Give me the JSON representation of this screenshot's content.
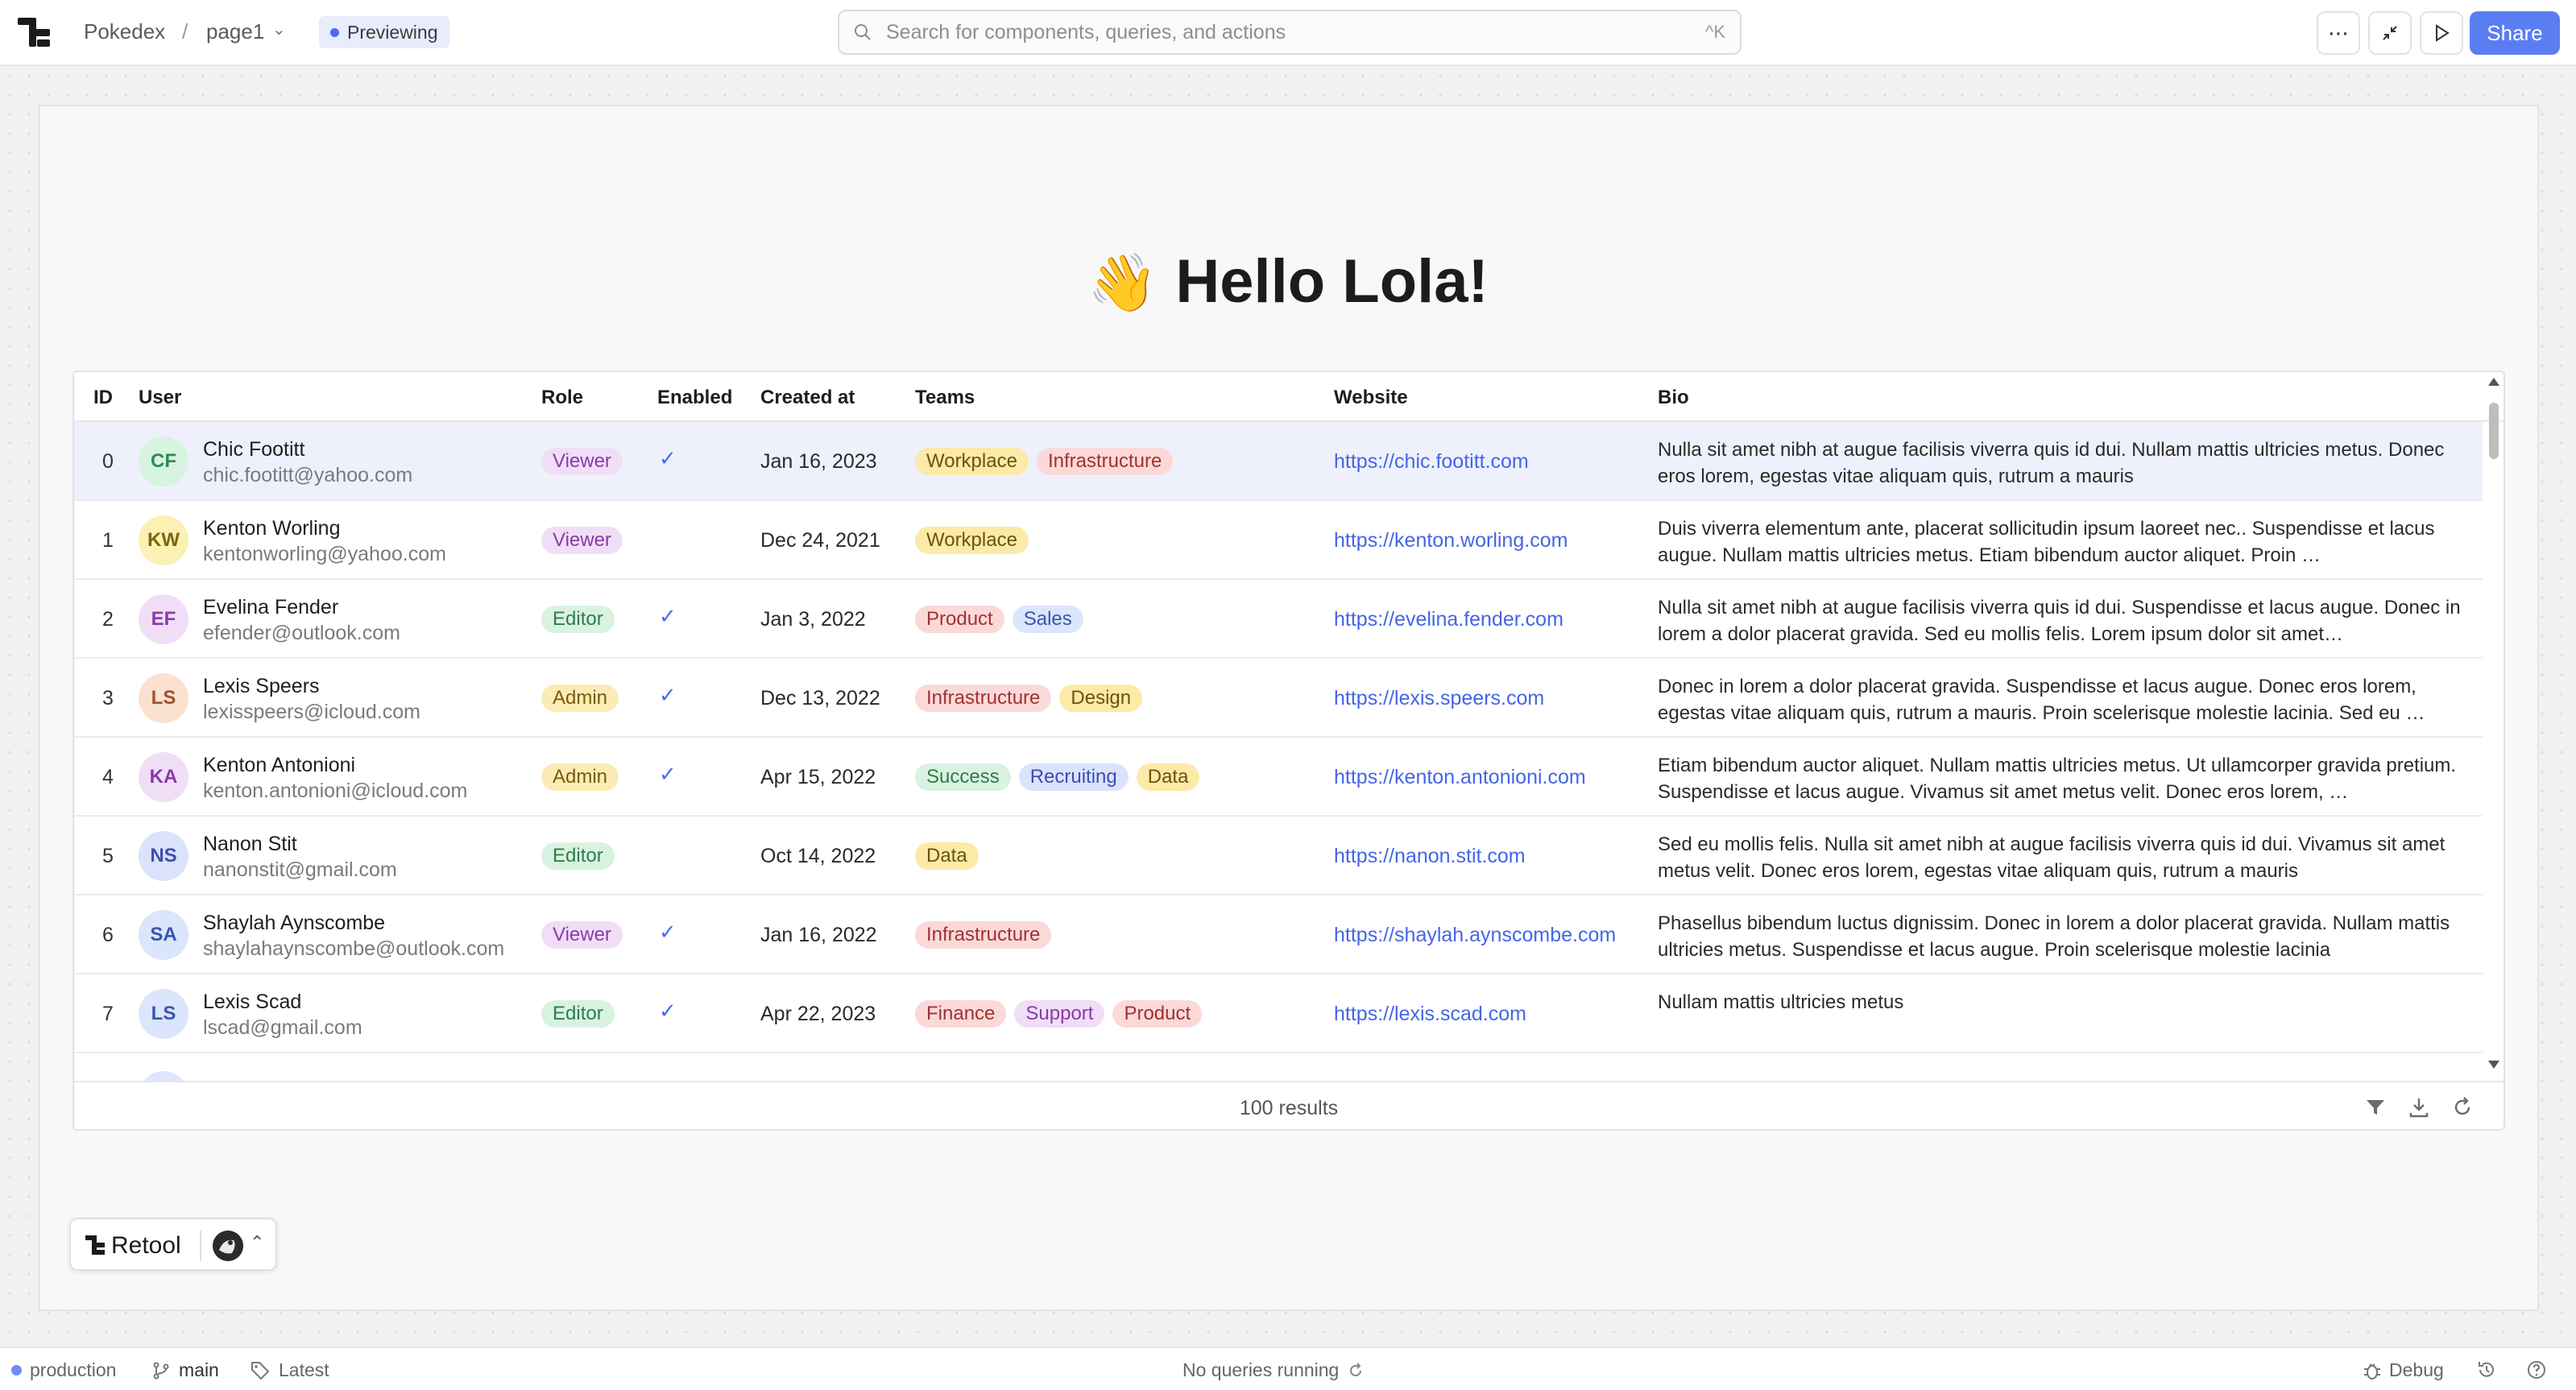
{
  "app": {
    "name": "Pokedex",
    "separator": "/",
    "page": "page1",
    "mode_badge": "Previewing"
  },
  "search": {
    "placeholder": "Search for components, queries, and actions",
    "shortcut": "^K"
  },
  "toolbar": {
    "more_icon": "more-horizontal-icon",
    "collapse_icon": "minimize-icon",
    "play_icon": "play-icon",
    "share_label": "Share"
  },
  "canvas": {
    "greeting_emoji": "👋",
    "greeting": "Hello Lola!"
  },
  "table": {
    "columns": [
      "ID",
      "User",
      "Role",
      "Enabled",
      "Created at",
      "Teams",
      "Website",
      "Bio"
    ],
    "rows": [
      {
        "id": "0",
        "initials": "CF",
        "name": "Chic Footitt",
        "email": "chic.footitt@yahoo.com",
        "role": "Viewer",
        "enabled": true,
        "created": "Jan 16, 2023",
        "teams": [
          "Workplace",
          "Infrastructure"
        ],
        "website": "https://chic.footitt.com",
        "bio": "Nulla sit amet nibh at augue facilisis viverra quis id dui. Nullam mattis ultricies metus. Donec eros lorem, egestas vitae aliquam quis, rutrum a mauris"
      },
      {
        "id": "1",
        "initials": "KW",
        "name": "Kenton Worling",
        "email": "kentonworling@yahoo.com",
        "role": "Viewer",
        "enabled": false,
        "created": "Dec 24, 2021",
        "teams": [
          "Workplace"
        ],
        "website": "https://kenton.worling.com",
        "bio": "Duis viverra elementum ante, placerat sollicitudin ipsum laoreet nec.. Suspendisse et lacus augue. Nullam mattis ultricies metus. Etiam bibendum auctor aliquet. Proin …"
      },
      {
        "id": "2",
        "initials": "EF",
        "name": "Evelina Fender",
        "email": "efender@outlook.com",
        "role": "Editor",
        "enabled": true,
        "created": "Jan 3, 2022",
        "teams": [
          "Product",
          "Sales"
        ],
        "website": "https://evelina.fender.com",
        "bio": "Nulla sit amet nibh at augue facilisis viverra quis id dui. Suspendisse et lacus augue. Donec in lorem a dolor placerat gravida. Sed eu mollis felis. Lorem ipsum dolor sit amet…"
      },
      {
        "id": "3",
        "initials": "LS",
        "name": "Lexis Speers",
        "email": "lexisspeers@icloud.com",
        "role": "Admin",
        "enabled": true,
        "created": "Dec 13, 2022",
        "teams": [
          "Infrastructure",
          "Design"
        ],
        "website": "https://lexis.speers.com",
        "bio": "Donec in lorem a dolor placerat gravida. Suspendisse et lacus augue. Donec eros lorem, egestas vitae aliquam quis, rutrum a mauris. Proin scelerisque molestie lacinia. Sed eu …"
      },
      {
        "id": "4",
        "initials": "KA",
        "name": "Kenton Antonioni",
        "email": "kenton.antonioni@icloud.com",
        "role": "Admin",
        "enabled": true,
        "created": "Apr 15, 2022",
        "teams": [
          "Success",
          "Recruiting",
          "Data"
        ],
        "website": "https://kenton.antonioni.com",
        "bio": "Etiam bibendum auctor aliquet. Nullam mattis ultricies metus. Ut ullamcorper gravida pretium. Suspendisse et lacus augue. Vivamus sit amet metus velit. Donec eros lorem, …"
      },
      {
        "id": "5",
        "initials": "NS",
        "name": "Nanon Stit",
        "email": "nanonstit@gmail.com",
        "role": "Editor",
        "enabled": false,
        "created": "Oct 14, 2022",
        "teams": [
          "Data"
        ],
        "website": "https://nanon.stit.com",
        "bio": "Sed eu mollis felis. Nulla sit amet nibh at augue facilisis viverra quis id dui. Vivamus sit amet metus velit. Donec eros lorem, egestas vitae aliquam quis, rutrum a mauris"
      },
      {
        "id": "6",
        "initials": "SA",
        "name": "Shaylah Aynscombe",
        "email": "shaylahaynscombe@outlook.com",
        "role": "Viewer",
        "enabled": true,
        "created": "Jan 16, 2022",
        "teams": [
          "Infrastructure"
        ],
        "website": "https://shaylah.aynscombe.com",
        "bio": "Phasellus bibendum luctus dignissim. Donec in lorem a dolor placerat gravida. Nullam mattis ultricies metus. Suspendisse et lacus augue. Proin scelerisque molestie lacinia"
      },
      {
        "id": "7",
        "initials": "LS",
        "name": "Lexis Scad",
        "email": "lscad@gmail.com",
        "role": "Editor",
        "enabled": true,
        "created": "Apr 22, 2023",
        "teams": [
          "Finance",
          "Support",
          "Product"
        ],
        "website": "https://lexis.scad.com",
        "bio": "Nullam mattis ultricies metus"
      }
    ],
    "footer": {
      "results": "100 results"
    }
  },
  "colors": {
    "accent": "#4b6cf0",
    "selected_row": "#eef1fc",
    "link": "#4465e8"
  },
  "retool_badge": {
    "label": "Retool"
  },
  "statusbar": {
    "environment": "production",
    "branch": "main",
    "release": "Latest",
    "queries": "No queries running",
    "debug": "Debug"
  }
}
